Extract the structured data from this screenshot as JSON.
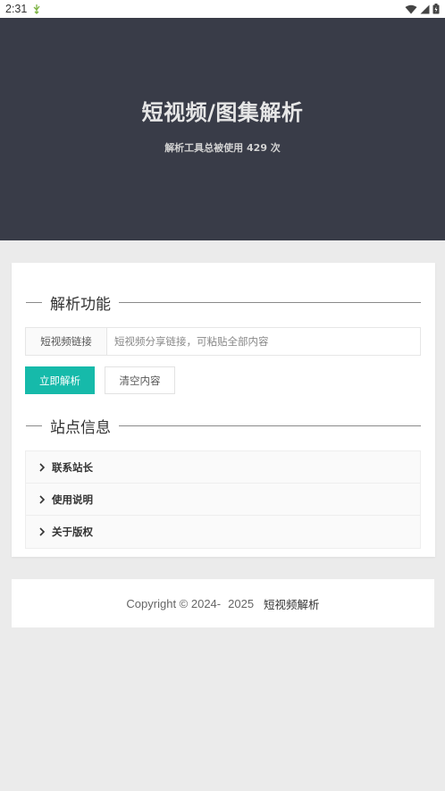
{
  "status_bar": {
    "time": "2:31",
    "icons": [
      "app-notification-icon",
      "wifi-icon",
      "cell-signal-icon",
      "battery-icon"
    ]
  },
  "header": {
    "title": "短视频/图集解析",
    "subtitle": "解析工具总被使用 429 次"
  },
  "parse_section": {
    "legend": "解析功能",
    "input_label": "短视频链接",
    "input_value": "",
    "input_placeholder": "短视频分享链接，可粘贴全部内容",
    "parse_button": "立即解析",
    "clear_button": "清空内容"
  },
  "site_section": {
    "legend": "站点信息",
    "items": [
      {
        "label": "联系站长"
      },
      {
        "label": "使用说明"
      },
      {
        "label": "关于版权"
      }
    ]
  },
  "footer": {
    "copyright": "Copyright © 2024-",
    "year_end": "2025",
    "site_name": "短视频解析"
  },
  "colors": {
    "header_bg": "#393c48",
    "primary": "#16baaa",
    "page_bg": "#ebebeb"
  }
}
